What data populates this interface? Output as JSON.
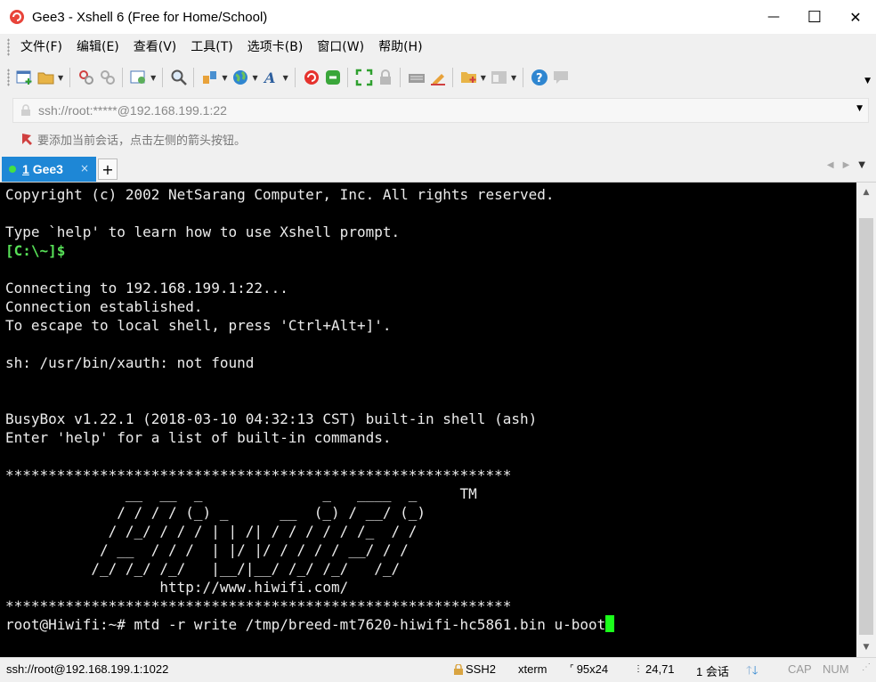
{
  "window": {
    "title": "Gee3 - Xshell 6 (Free for Home/School)",
    "minimize_glyph": "—",
    "maximize_glyph": "☐",
    "close_glyph": "✕"
  },
  "menu": [
    "文件(F)",
    "编辑(E)",
    "查看(V)",
    "工具(T)",
    "选项卡(B)",
    "窗口(W)",
    "帮助(H)"
  ],
  "toolbar": {
    "icons": [
      "new-session-icon",
      "open-folder-icon",
      "connect-icon",
      "disconnect-icon",
      "properties-icon",
      "find-icon",
      "transfer-icon",
      "globe-icon",
      "font-icon",
      "xshell-icon",
      "xftp-icon",
      "fullscreen-icon",
      "lock-icon",
      "keyboard-icon",
      "highlight-icon",
      "compose-icon",
      "layout-icon",
      "help-icon",
      "chat-icon"
    ]
  },
  "address": {
    "value": "ssh://root:*****@192.168.199.1:22"
  },
  "hint": {
    "text": "要添加当前会话，点击左侧的箭头按钮。"
  },
  "tab": {
    "number": "1",
    "name": "Gee3",
    "close": "×",
    "new_tab": "+"
  },
  "terminal": {
    "lines": [
      "Copyright (c) 2002 NetSarang Computer, Inc. All rights reserved.",
      "",
      "Type `help' to learn how to use Xshell prompt.",
      "[C:\\~]$",
      "",
      "Connecting to 192.168.199.1:22...",
      "Connection established.",
      "To escape to local shell, press 'Ctrl+Alt+]'.",
      "",
      "sh: /usr/bin/xauth: not found",
      "",
      "",
      "BusyBox v1.22.1 (2018-03-10 04:32:13 CST) built-in shell (ash)",
      "Enter 'help' for a list of built-in commands.",
      "",
      "***********************************************************",
      "              __  __  _              _   ____  _     TM",
      "             / / / / (_) _      __  (_) / __/ (_)",
      "            / /_/ / / / | | /| / / / / / /_  / /",
      "           / __  / / /  | |/ |/ / / / / __/ / /",
      "          /_/ /_/ /_/   |__/|__/ /_/ /_/   /_/",
      "                  http://www.hiwifi.com/",
      "***********************************************************",
      "root@Hiwifi:~# mtd -r write /tmp/breed-mt7620-hiwifi-hc5861.bin u-boot"
    ],
    "green_line_index": 3,
    "cursor_line_index": 23
  },
  "status": {
    "connection": "ssh://root@192.168.199.1:1022",
    "protocol": "SSH2",
    "term_type": "xterm",
    "size": "95x24",
    "position": "24,71",
    "sessions": "1 会话",
    "cap": "CAP",
    "num": "NUM"
  },
  "colors": {
    "tab_active": "#1e87d6",
    "terminal_bg": "#000000",
    "prompt_green": "#57e057",
    "cursor": "#1bff1b"
  }
}
